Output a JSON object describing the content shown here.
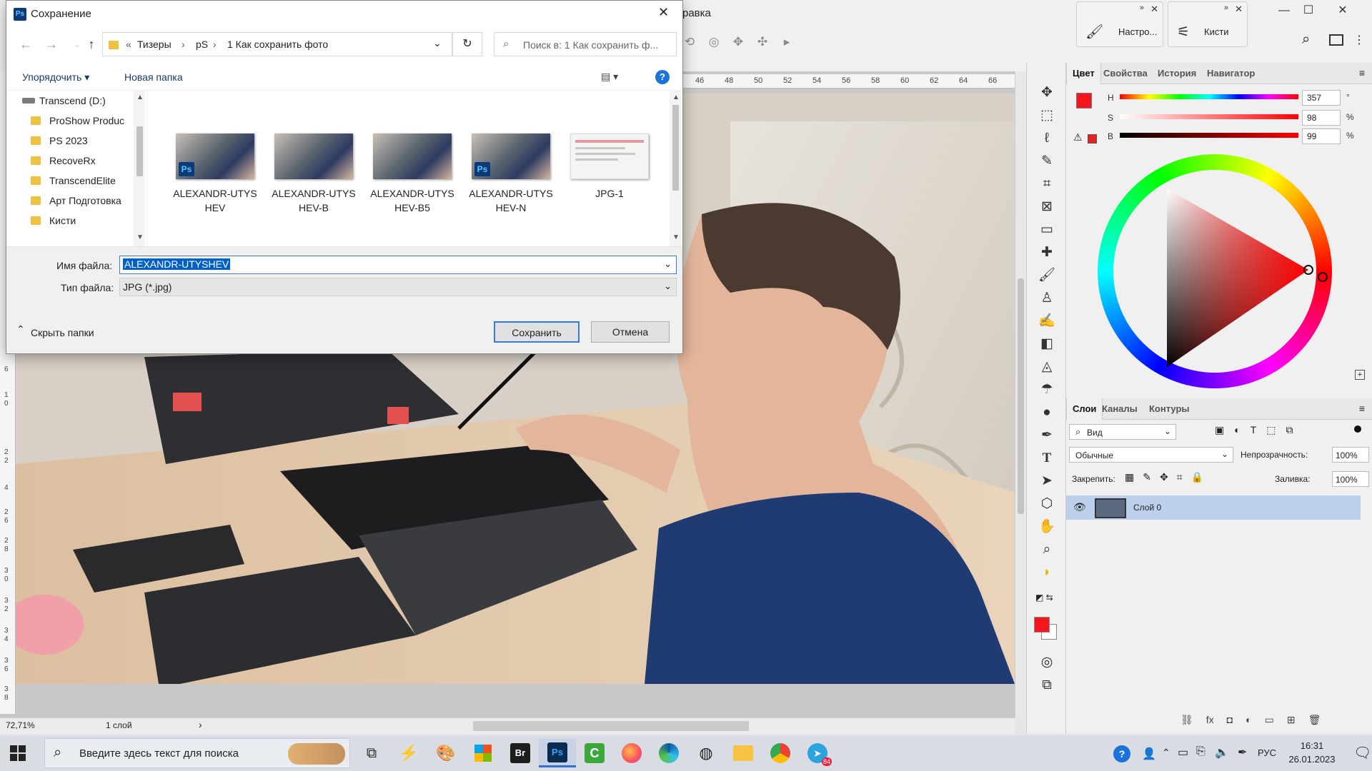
{
  "photoshop": {
    "menu_partial": "равка",
    "window_controls": {
      "minimize": "—",
      "maximize": "☐",
      "close": "✕"
    },
    "mini_panels": [
      {
        "label": "Настро...",
        "icon": "brush-settings-icon"
      },
      {
        "label": "Кисти",
        "icon": "brushes-icon"
      }
    ],
    "ruler_h": [
      "46",
      "48",
      "50",
      "52",
      "54",
      "56",
      "58",
      "60",
      "62",
      "64",
      "66"
    ],
    "ruler_v": [
      "6",
      "1",
      "0",
      "2",
      "2",
      "4",
      "2",
      "6",
      "2",
      "8",
      "3",
      "0",
      "3",
      "2",
      "3",
      "4",
      "3",
      "6",
      "3",
      "8"
    ],
    "status": {
      "zoom": "72,71%",
      "layers_info": "1 слой"
    },
    "color_panel": {
      "tabs": [
        "Цвет",
        "Свойства",
        "История",
        "Навигатор"
      ],
      "h_label": "H",
      "h_value": "357",
      "h_unit": "°",
      "s_label": "S",
      "s_value": "98",
      "s_unit": "%",
      "b_label": "B",
      "b_value": "99",
      "b_unit": "%",
      "foreground_color": "#f5151f"
    },
    "layers_panel": {
      "tabs": [
        "Слои",
        "Каналы",
        "Контуры"
      ],
      "filter_label": "Вид",
      "blend_mode": "Обычные",
      "opacity_label": "Непрозрачность:",
      "opacity_value": "100%",
      "lock_label": "Закрепить:",
      "fill_label": "Заливка:",
      "fill_value": "100%",
      "layers": [
        {
          "name": "Слой 0",
          "visible": true
        }
      ]
    }
  },
  "dialog": {
    "title": "Сохранение",
    "close": "✕",
    "breadcrumb": [
      "«",
      "Тизеры",
      "›",
      "pS",
      "›",
      "1 Как сохранить фото"
    ],
    "search_placeholder": "Поиск в: 1 Как сохранить ф...",
    "organize_label": "Упорядочить ▾",
    "new_folder_label": "Новая папка",
    "help_label": "?",
    "nav_items": [
      "Transcend (D:)",
      "ProShow Produc",
      "PS 2023",
      "RecoveRx",
      "TranscendElite",
      "Арт Подготовка",
      "Кисти"
    ],
    "files": [
      {
        "name": "ALEXANDR-UTYS HEV",
        "ps": true
      },
      {
        "name": "ALEXANDR-UTYS HEV-B",
        "ps": false
      },
      {
        "name": "ALEXANDR-UTYS HEV-B5",
        "ps": false
      },
      {
        "name": "ALEXANDR-UTYS HEV-N",
        "ps": true
      },
      {
        "name": "JPG-1",
        "ps": false
      }
    ],
    "filename_label": "Имя файла:",
    "filename_value": "ALEXANDR-UTYSHEV",
    "filetype_label": "Тип файла:",
    "filetype_value": "JPG (*.jpg)",
    "hide_folders_label": "Скрыть папки",
    "save_label": "Сохранить",
    "cancel_label": "Отмена"
  },
  "taskbar": {
    "search_placeholder": "Введите здесь текст для поиска",
    "apps": [
      "task-view-icon",
      "reaper-icon",
      "paint-icon",
      "store-icon",
      "bridge-icon",
      "photoshop-icon",
      "camtasia-icon",
      "firefox-icon",
      "edge-icon",
      "search-app-icon",
      "explorer-icon",
      "chrome-icon",
      "telegram-icon"
    ],
    "bridge_label": "Br",
    "ps_label": "Ps",
    "telegram_badge": "84",
    "lang": "РУС",
    "time": "16:31",
    "date": "26.01.2023"
  }
}
